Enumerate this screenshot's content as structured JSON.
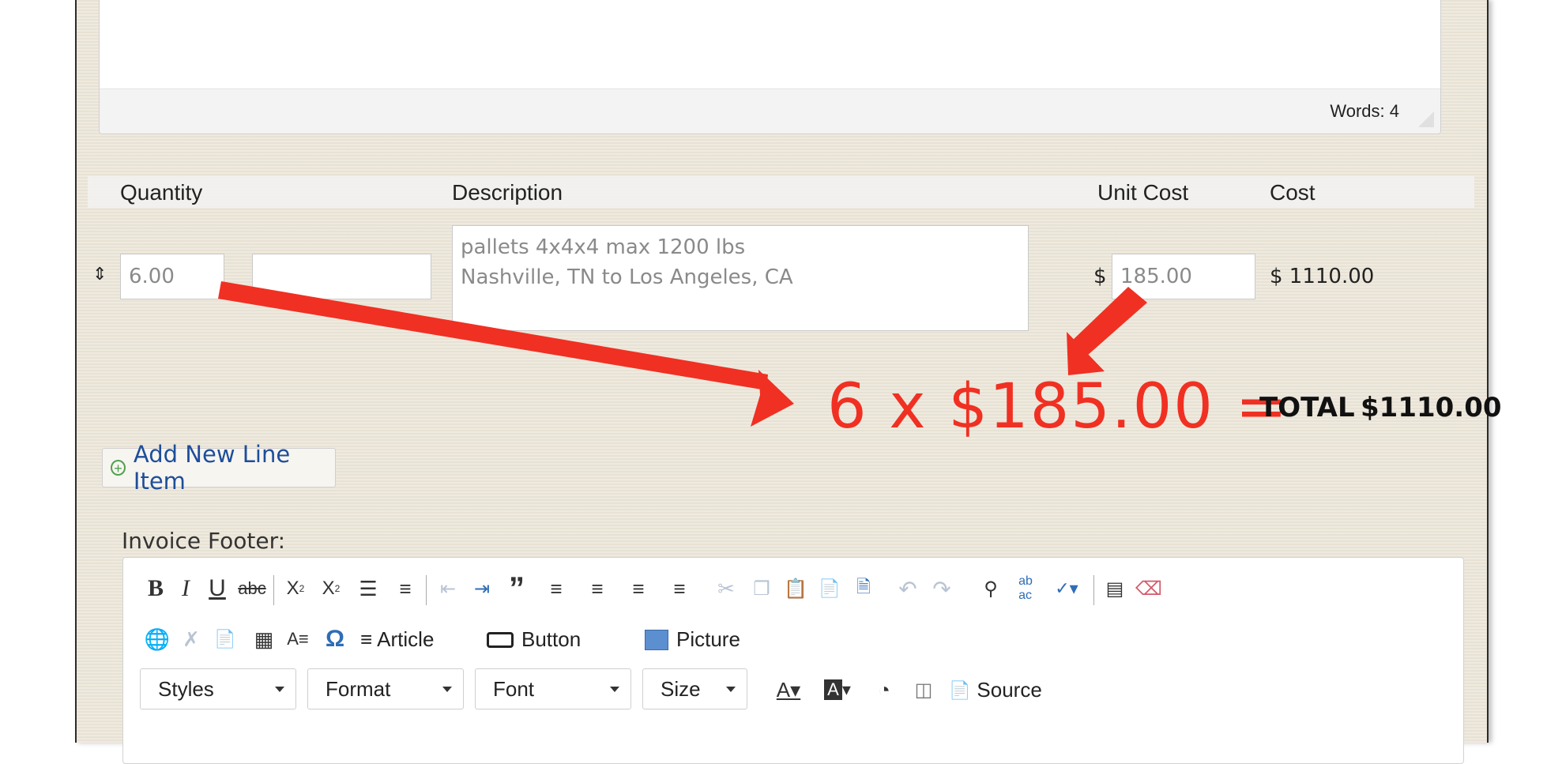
{
  "top_editor": {
    "word_count": "Words: 4"
  },
  "table": {
    "headers": {
      "quantity": "Quantity",
      "description": "Description",
      "unit_cost": "Unit Cost",
      "cost": "Cost"
    },
    "row": {
      "quantity": "6.00",
      "unit": "",
      "description_line1": "pallets 4x4x4 max 1200 lbs",
      "description_line2": "Nashville, TN to Los Angeles, CA",
      "currency": "$",
      "unit_cost": "185.00",
      "cost": "$ 1110.00"
    }
  },
  "annotation": {
    "formula": "6 x $185.00 =",
    "total_label": "TOTAL",
    "total_value": "$1110.00",
    "color": "#f03022"
  },
  "add_line_item": "Add New Line Item",
  "invoice_footer": {
    "label": "Invoice Footer:",
    "buttons": {
      "article": "Article",
      "button": "Button",
      "picture": "Picture",
      "source": "Source"
    },
    "combos": {
      "styles": "Styles",
      "format": "Format",
      "font": "Font",
      "size": "Size"
    }
  },
  "icons": [
    "bold-icon",
    "italic-icon",
    "underline-icon",
    "strikethrough-icon",
    "subscript-icon",
    "superscript-icon",
    "numbered-list-icon",
    "bulleted-list-icon",
    "decrease-indent-icon",
    "increase-indent-icon",
    "blockquote-icon",
    "align-left-icon",
    "align-center-icon",
    "align-right-icon",
    "justify-icon",
    "cut-icon",
    "copy-icon",
    "paste-icon",
    "paste-text-icon",
    "paste-word-icon",
    "undo-icon",
    "redo-icon",
    "find-icon",
    "replace-icon",
    "spellcheck-icon",
    "template-icon",
    "remove-format-icon",
    "link-icon",
    "unlink-icon",
    "anchor-icon",
    "table-icon",
    "horizontal-rule-icon",
    "special-char-icon",
    "text-color-icon",
    "bg-color-icon",
    "maximize-icon",
    "show-blocks-icon",
    "source-icon"
  ]
}
